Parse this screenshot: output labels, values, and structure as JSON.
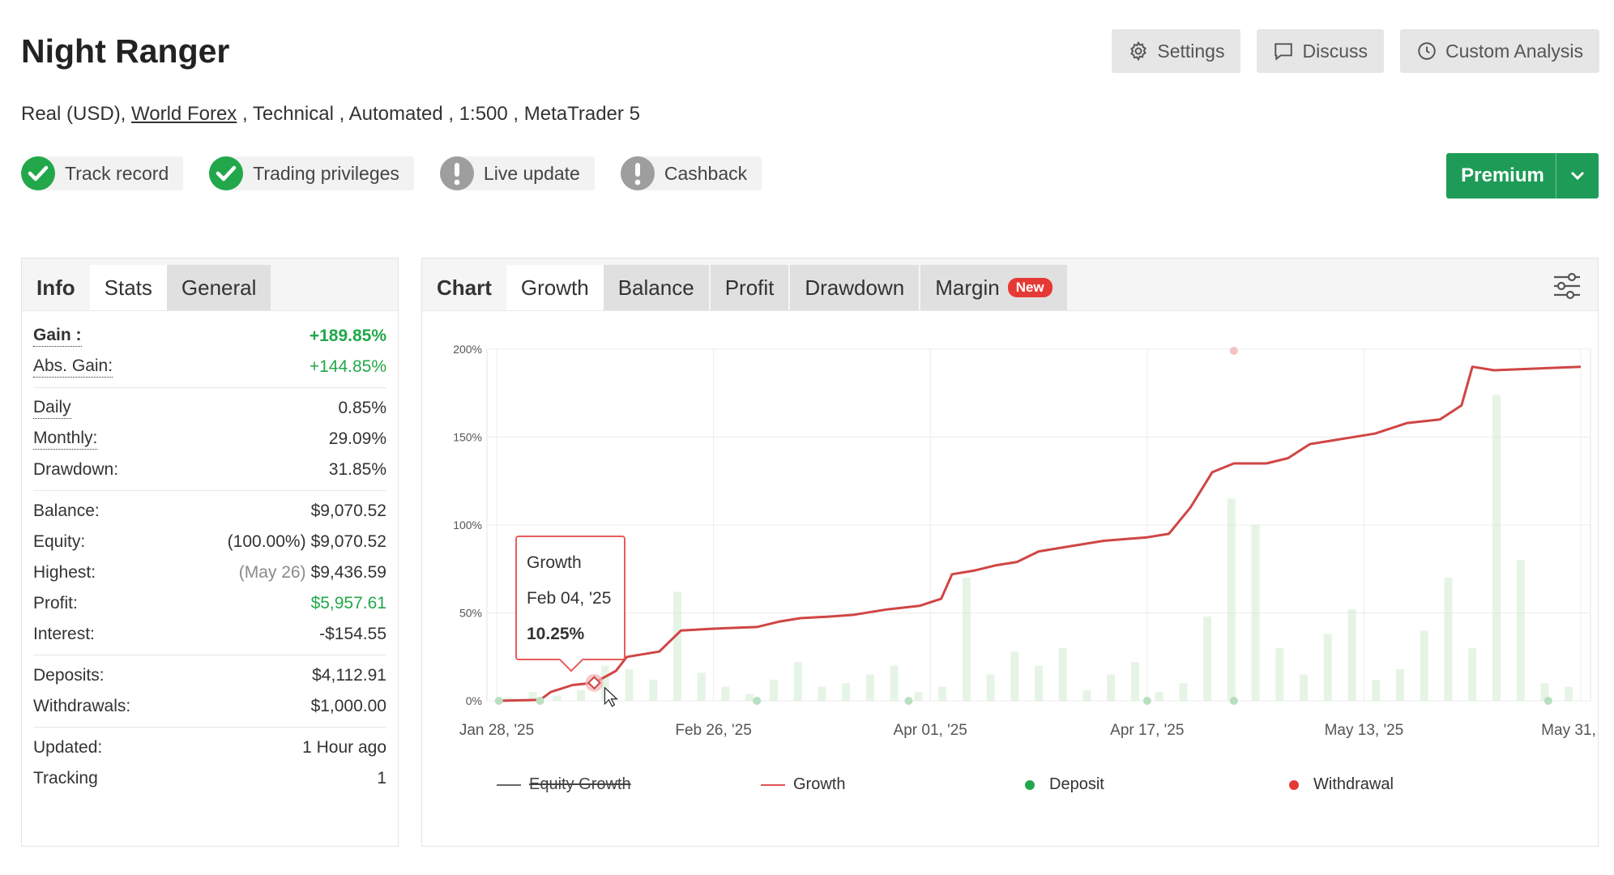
{
  "header": {
    "title": "Night Ranger",
    "subtitle": {
      "account": "Real (USD),",
      "broker_link": "World Forex",
      "rest": ", Technical , Automated , 1:500 , MetaTrader 5"
    },
    "actions": [
      {
        "label": "Settings",
        "icon": "gear-icon"
      },
      {
        "label": "Discuss",
        "icon": "chat-icon"
      },
      {
        "label": "Custom Analysis",
        "icon": "clock-icon"
      }
    ],
    "badges": [
      {
        "label": "Track record",
        "icon": "check-circle-icon",
        "color": "#22a84a"
      },
      {
        "label": "Trading privileges",
        "icon": "check-circle-icon",
        "color": "#22a84a"
      },
      {
        "label": "Live update",
        "icon": "exclamation-circle-icon",
        "color": "#9e9e9e"
      },
      {
        "label": "Cashback",
        "icon": "exclamation-circle-icon",
        "color": "#9e9e9e"
      }
    ],
    "premium": {
      "label": "Premium",
      "color": "#1e9c57"
    }
  },
  "left_tabs": [
    "Info",
    "Stats",
    "General"
  ],
  "stats": {
    "gain": {
      "label": "Gain :",
      "value": "+189.85%"
    },
    "abs_gain": {
      "label": "Abs. Gain:",
      "value": "+144.85%"
    },
    "daily": {
      "label": "Daily",
      "value": "0.85%"
    },
    "monthly": {
      "label": "Monthly:",
      "value": "29.09%"
    },
    "drawdown": {
      "label": "Drawdown:",
      "value": "31.85%"
    },
    "balance": {
      "label": "Balance:",
      "value": "$9,070.52"
    },
    "equity": {
      "label": "Equity:",
      "note": "(100.00%)",
      "value": "$9,070.52"
    },
    "highest": {
      "label": "Highest:",
      "note": "(May 26)",
      "value": "$9,436.59"
    },
    "profit": {
      "label": "Profit:",
      "value": "$5,957.61"
    },
    "interest": {
      "label": "Interest:",
      "value": "-$154.55"
    },
    "deposits": {
      "label": "Deposits:",
      "value": "$4,112.91"
    },
    "withdrawals": {
      "label": "Withdrawals:",
      "value": "$1,000.00"
    },
    "updated": {
      "label": "Updated:",
      "value": "1 Hour ago"
    },
    "tracking": {
      "label": "Tracking",
      "value": "1"
    }
  },
  "chart_tabs": {
    "label": "Chart",
    "items": [
      "Growth",
      "Balance",
      "Profit",
      "Drawdown",
      "Margin"
    ],
    "new_badge": "New"
  },
  "tooltip": {
    "title": "Growth",
    "date": "Feb 04, '25",
    "value": "10.25%"
  },
  "legend": [
    {
      "label": "Equity Growth",
      "color": "#666666",
      "kind": "line",
      "disabled": true
    },
    {
      "label": "Growth",
      "color": "#e05555",
      "kind": "line"
    },
    {
      "label": "Deposit",
      "color": "#22a84a",
      "kind": "dot"
    },
    {
      "label": "Withdrawal",
      "color": "#e53935",
      "kind": "dot"
    }
  ],
  "chart_data": {
    "type": "line",
    "x_ticks": [
      "Jan 28, '25",
      "Feb 26, '25",
      "Apr 01, '25",
      "Apr 17, '25",
      "May 13, '25",
      "May 31, '25"
    ],
    "y_ticks": [
      "0%",
      "50%",
      "100%",
      "150%",
      "200%"
    ],
    "ylim": [
      0,
      200
    ],
    "grid": true,
    "series": [
      {
        "name": "Growth",
        "color": "#d04545",
        "points": [
          [
            0,
            0
          ],
          [
            0.04,
            0.5
          ],
          [
            0.05,
            5
          ],
          [
            0.07,
            9
          ],
          [
            0.09,
            10.25
          ],
          [
            0.11,
            17
          ],
          [
            0.12,
            25
          ],
          [
            0.15,
            28
          ],
          [
            0.17,
            40
          ],
          [
            0.2,
            41
          ],
          [
            0.24,
            42
          ],
          [
            0.26,
            45
          ],
          [
            0.28,
            47
          ],
          [
            0.31,
            48
          ],
          [
            0.33,
            49
          ],
          [
            0.36,
            52
          ],
          [
            0.39,
            54
          ],
          [
            0.41,
            58
          ],
          [
            0.42,
            72
          ],
          [
            0.44,
            74
          ],
          [
            0.46,
            77
          ],
          [
            0.48,
            79
          ],
          [
            0.5,
            85
          ],
          [
            0.53,
            88
          ],
          [
            0.56,
            91
          ],
          [
            0.6,
            93
          ],
          [
            0.62,
            95
          ],
          [
            0.64,
            110
          ],
          [
            0.66,
            130
          ],
          [
            0.68,
            135
          ],
          [
            0.71,
            135
          ],
          [
            0.73,
            138
          ],
          [
            0.75,
            146
          ],
          [
            0.78,
            149
          ],
          [
            0.81,
            152
          ],
          [
            0.84,
            158
          ],
          [
            0.87,
            160
          ],
          [
            0.89,
            168
          ],
          [
            0.9,
            190
          ],
          [
            0.92,
            188
          ],
          [
            1.0,
            190
          ]
        ]
      }
    ],
    "bars": [
      2,
      5,
      3,
      6,
      20,
      18,
      12,
      62,
      16,
      8,
      4,
      12,
      22,
      8,
      10,
      15,
      20,
      5,
      8,
      70,
      15,
      28,
      20,
      30,
      6,
      15,
      22,
      5,
      10,
      48,
      115,
      100,
      30,
      15,
      38,
      52,
      12,
      18,
      40,
      70,
      30,
      174,
      80,
      10,
      8
    ]
  }
}
